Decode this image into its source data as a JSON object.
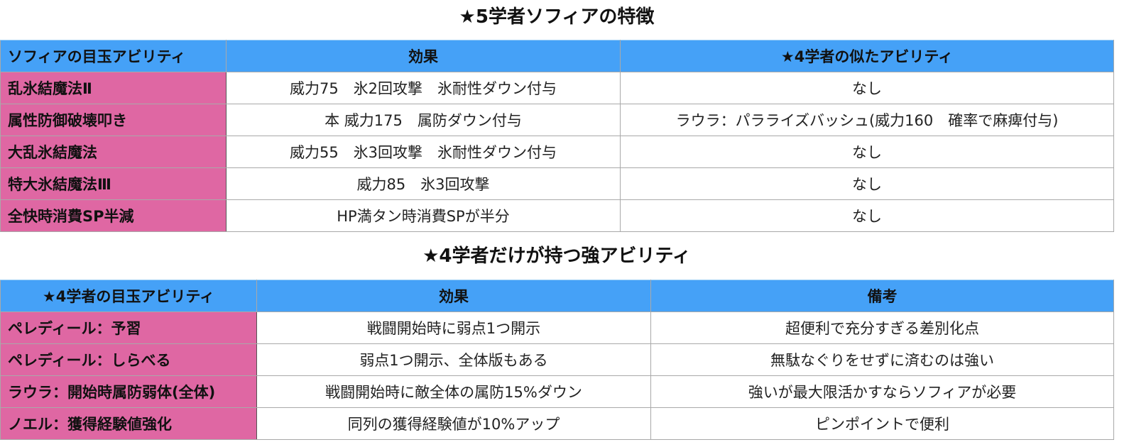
{
  "section1": {
    "title": "★5学者ソフィアの特徴",
    "headers": [
      "ソフィアの目玉アビリティ",
      "効果",
      "★4学者の似たアビリティ"
    ],
    "rows": [
      {
        "name": "乱氷結魔法Ⅱ",
        "effect": "威力75　氷2回攻撃　氷耐性ダウン付与",
        "similar": "なし"
      },
      {
        "name": "属性防御破壊叩き",
        "effect": "本 威力175　属防ダウン付与",
        "similar": "ラウラ：パラライズバッシュ(威力160　確率で麻痺付与)"
      },
      {
        "name": "大乱氷結魔法",
        "effect": "威力55　氷3回攻撃　氷耐性ダウン付与",
        "similar": "なし"
      },
      {
        "name": "特大氷結魔法Ⅲ",
        "effect": "威力85　氷3回攻撃",
        "similar": "なし"
      },
      {
        "name": "全快時消費SP半減",
        "effect": "HP満タン時消費SPが半分",
        "similar": "なし"
      }
    ]
  },
  "section2": {
    "title": "★4学者だけが持つ強アビリティ",
    "headers": [
      "★4学者の目玉アビリティ",
      "効果",
      "備考"
    ],
    "rows": [
      {
        "name": "ペレディール：予習",
        "effect": "戦闘開始時に弱点1つ開示",
        "note": "超便利で充分すぎる差別化点"
      },
      {
        "name": "ペレディール：しらべる",
        "effect": "弱点1つ開示、全体版もある",
        "note": "無駄なぐりをせずに済むのは強い"
      },
      {
        "name": "ラウラ：開始時属防弱体(全体)",
        "effect": "戦闘開始時に敵全体の属防15%ダウン",
        "note": "強いが最大限活かすならソフィアが必要"
      },
      {
        "name": "ノエル：獲得経験値強化",
        "effect": "同列の獲得経験値が10%アップ",
        "note": "ピンポイントで便利"
      }
    ]
  },
  "colors": {
    "header_bg": "#45a1f7",
    "name_cell_bg": "#df67a3",
    "grid_line": "#a9a9a9"
  }
}
